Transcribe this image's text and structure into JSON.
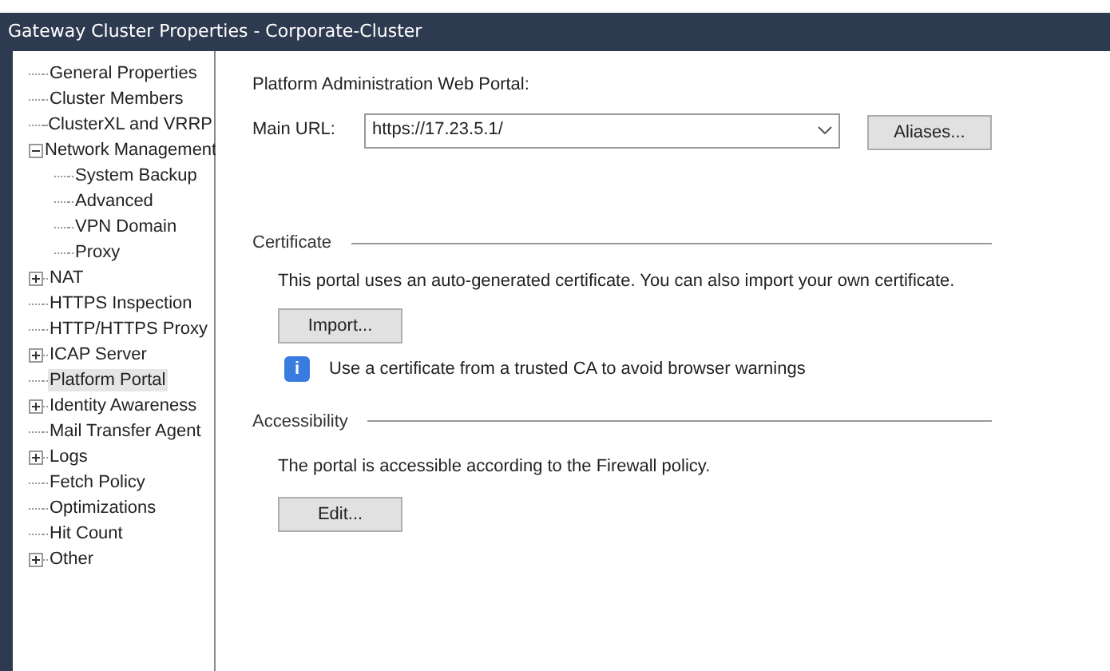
{
  "window": {
    "title": "Gateway Cluster Properties - Corporate-Cluster"
  },
  "tree": [
    {
      "label": "General Properties",
      "kind": "leaf",
      "selected": false
    },
    {
      "label": "Cluster Members",
      "kind": "leaf",
      "selected": false
    },
    {
      "label": "ClusterXL and VRRP",
      "kind": "leaf",
      "selected": false
    },
    {
      "label": "Network Management",
      "kind": "folder",
      "expanded": true,
      "selected": false,
      "children": [
        {
          "label": "System Backup",
          "kind": "leaf",
          "selected": false
        },
        {
          "label": "Advanced",
          "kind": "leaf",
          "selected": false
        },
        {
          "label": "VPN Domain",
          "kind": "leaf",
          "selected": false
        },
        {
          "label": "Proxy",
          "kind": "leaf",
          "selected": false
        }
      ]
    },
    {
      "label": "NAT",
      "kind": "folder",
      "expanded": false,
      "selected": false
    },
    {
      "label": "HTTPS Inspection",
      "kind": "leaf",
      "selected": false
    },
    {
      "label": "HTTP/HTTPS Proxy",
      "kind": "leaf",
      "selected": false
    },
    {
      "label": "ICAP Server",
      "kind": "folder",
      "expanded": false,
      "selected": false
    },
    {
      "label": "Platform Portal",
      "kind": "leaf",
      "selected": true
    },
    {
      "label": "Identity Awareness",
      "kind": "folder",
      "expanded": false,
      "selected": false
    },
    {
      "label": "Mail Transfer Agent",
      "kind": "leaf",
      "selected": false
    },
    {
      "label": "Logs",
      "kind": "folder",
      "expanded": false,
      "selected": false
    },
    {
      "label": "Fetch Policy",
      "kind": "leaf",
      "selected": false
    },
    {
      "label": "Optimizations",
      "kind": "leaf",
      "selected": false
    },
    {
      "label": "Hit Count",
      "kind": "leaf",
      "selected": false
    },
    {
      "label": "Other",
      "kind": "folder",
      "expanded": false,
      "selected": false
    }
  ],
  "portal": {
    "heading": "Platform Administration Web Portal:",
    "url_label": "Main URL:",
    "url_value": "https://17.23.5.1/",
    "aliases_button": "Aliases..."
  },
  "certificate": {
    "title": "Certificate",
    "text": "This portal uses an auto-generated certificate. You can also import your own certificate.",
    "button": "Import...",
    "info": "Use a certificate from a trusted CA to avoid browser warnings",
    "info_icon": "i"
  },
  "accessibility": {
    "title": "Accessibility",
    "text": "The portal is accessible according to the Firewall policy.",
    "button": "Edit..."
  }
}
